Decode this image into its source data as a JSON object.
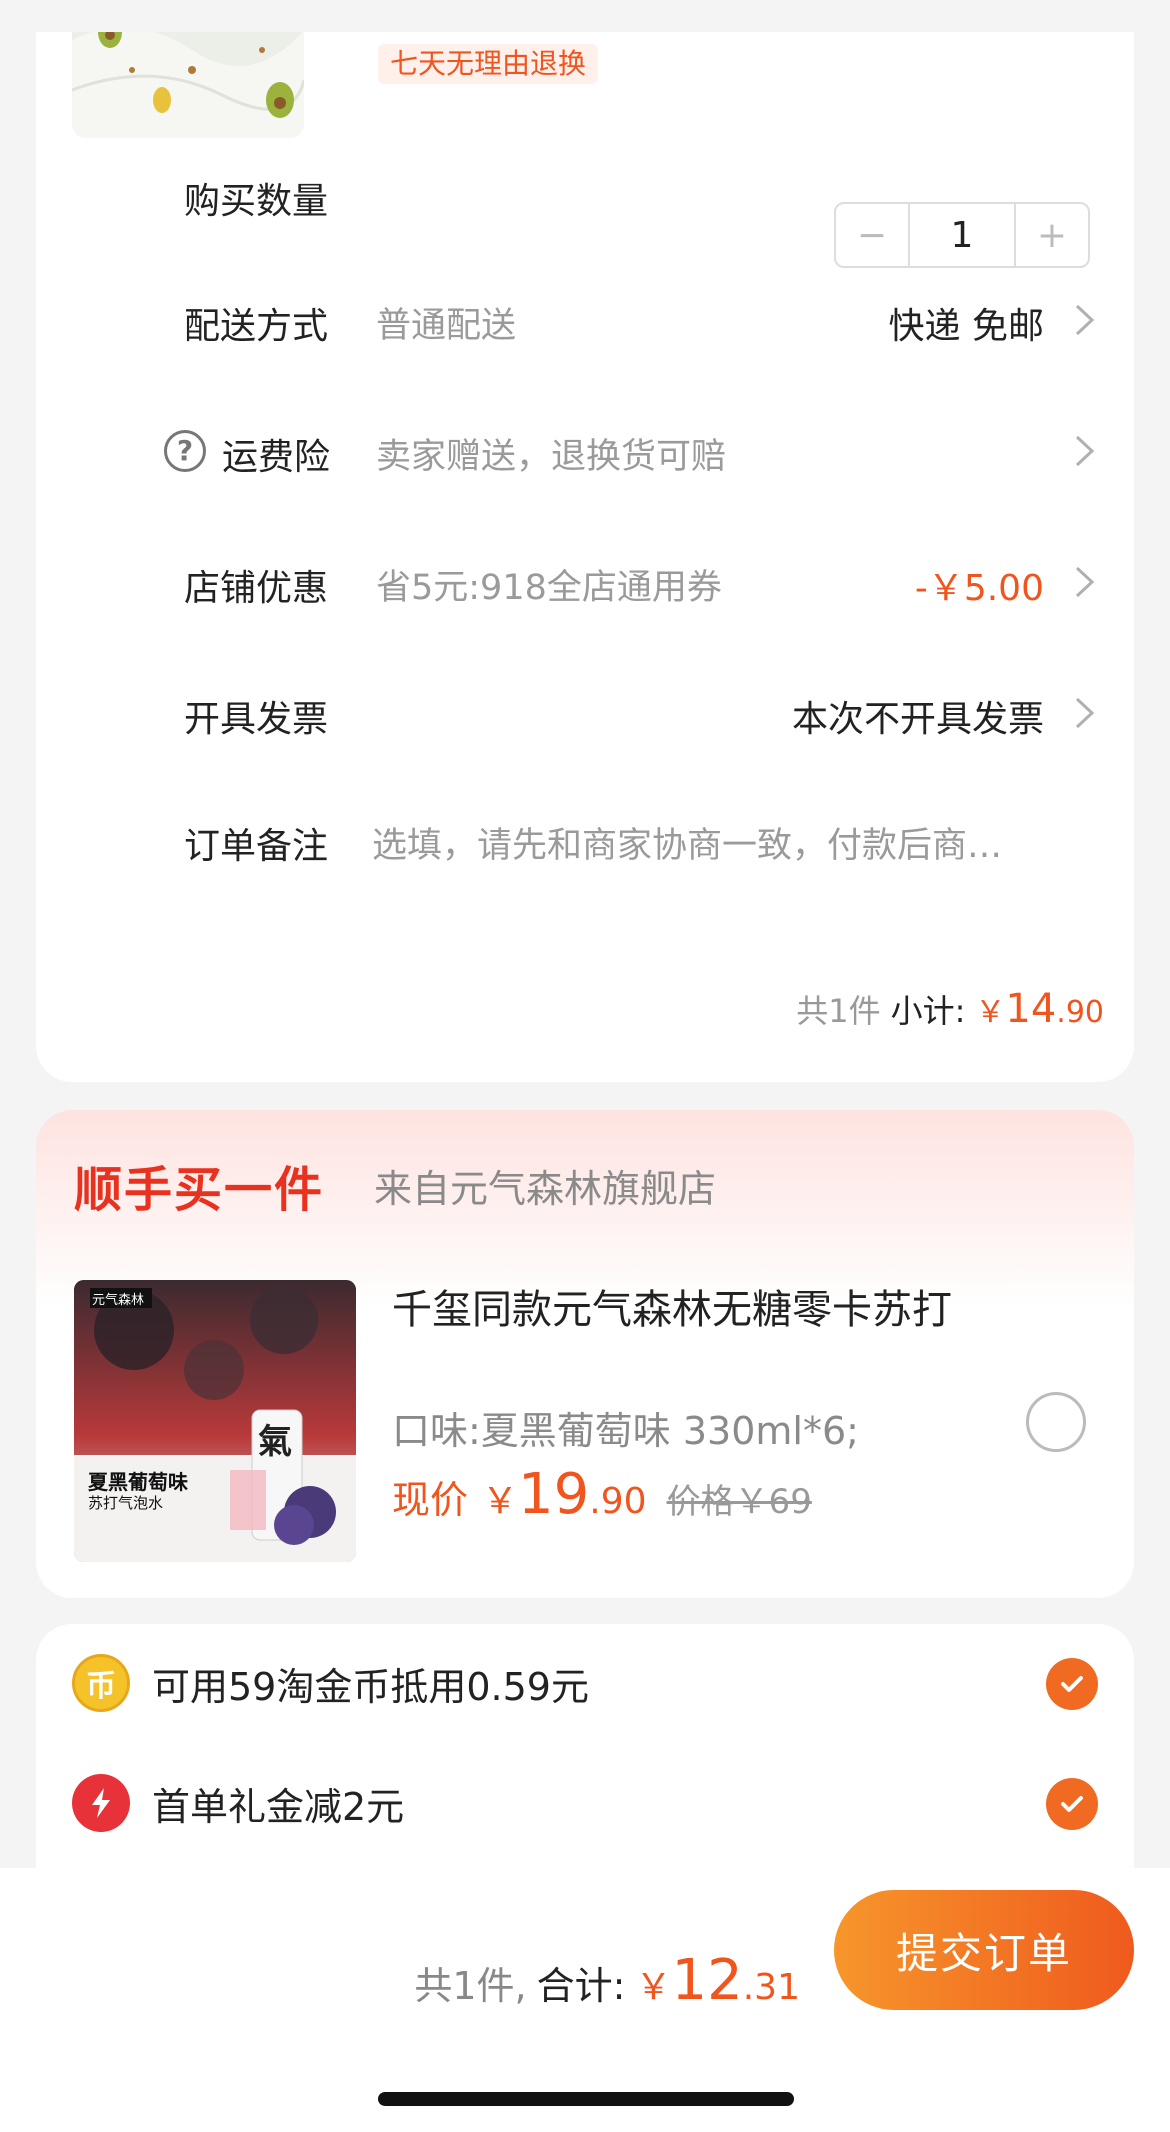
{
  "order": {
    "return_tag": "七天无理由退换",
    "quantity": {
      "label": "购买数量",
      "value": "1",
      "minus": "−",
      "plus": "+"
    },
    "delivery": {
      "label": "配送方式",
      "value": "普通配送",
      "right": "快递 免邮"
    },
    "insurance": {
      "label": "运费险",
      "value": "卖家赠送，退换货可赔",
      "icon_text": "?"
    },
    "shop_discount": {
      "label": "店铺优惠",
      "value": "省5元:918全店通用券",
      "right": "-￥5.00"
    },
    "invoice": {
      "label": "开具发票",
      "right": "本次不开具发票"
    },
    "note": {
      "label": "订单备注",
      "placeholder": "选填，请先和商家协商一致，付款后商…"
    },
    "subtotal": {
      "count": "共1件",
      "label": "小计:",
      "currency": "￥",
      "int": "14",
      "dec": ".90"
    }
  },
  "addon": {
    "title": "顺手买一件",
    "from": "来自元气森林旗舰店",
    "image_brand": "元气森林",
    "image_flavor": "夏黑葡萄味",
    "image_sub": "苏打气泡水",
    "image_can_char": "氣",
    "name": "千玺同款元气森林无糖零卡苏打",
    "spec": "口味:夏黑葡萄味 330ml*6;",
    "price_label": "现价",
    "currency": "￥",
    "price_int": "19",
    "price_dec": ".90",
    "old_price": "价格￥69"
  },
  "discounts": {
    "coins": {
      "text": "可用59淘金币抵用0.59元",
      "icon_char": "币"
    },
    "first_order": {
      "text": "首单礼金减2元"
    }
  },
  "footer": {
    "count": "共1件,",
    "label": "合计:",
    "currency": "￥",
    "total_int": "12",
    "total_dec": ".31",
    "submit": "提交订单"
  },
  "colors": {
    "accent": "#f0551e",
    "red": "#e8311f",
    "check": "#f06a22",
    "coin": "#f5c22a"
  }
}
